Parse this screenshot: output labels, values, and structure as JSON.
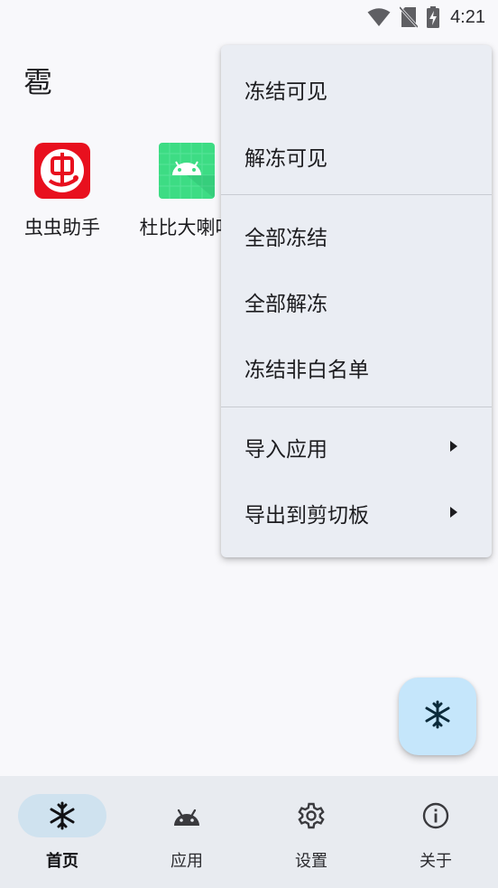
{
  "status_bar": {
    "time": "4:21",
    "icons": [
      "wifi-icon",
      "no-sim-icon",
      "battery-charging-icon"
    ]
  },
  "header": {
    "title": "雹"
  },
  "apps": [
    {
      "name": "虫虫助手",
      "icon": "chongchong-app-icon",
      "color": "#e8101e"
    },
    {
      "name": "杜比大喇叭",
      "icon": "android-app-icon",
      "color": "#3ddc84"
    }
  ],
  "menu": {
    "items": [
      {
        "label": "冻结可见",
        "has_submenu": false
      },
      {
        "label": "解冻可见",
        "has_submenu": false
      },
      {
        "label": "全部冻结",
        "has_submenu": false
      },
      {
        "label": "全部解冻",
        "has_submenu": false
      },
      {
        "label": "冻结非白名单",
        "has_submenu": false
      },
      {
        "label": "导入应用",
        "has_submenu": true
      },
      {
        "label": "导出到剪切板",
        "has_submenu": true
      }
    ]
  },
  "fab": {
    "icon": "snowflake-icon"
  },
  "bottom_nav": {
    "items": [
      {
        "label": "首页",
        "icon": "snowflake-icon",
        "active": true
      },
      {
        "label": "应用",
        "icon": "android-icon",
        "active": false
      },
      {
        "label": "设置",
        "icon": "gear-icon",
        "active": false
      },
      {
        "label": "关于",
        "icon": "info-icon",
        "active": false
      }
    ]
  },
  "colors": {
    "background": "#f8f8fb",
    "menu_background": "#eaedf3",
    "fab_background": "#c5e6fb",
    "nav_background": "#e8ebf0",
    "nav_active_indicator": "#cfe2ef"
  }
}
